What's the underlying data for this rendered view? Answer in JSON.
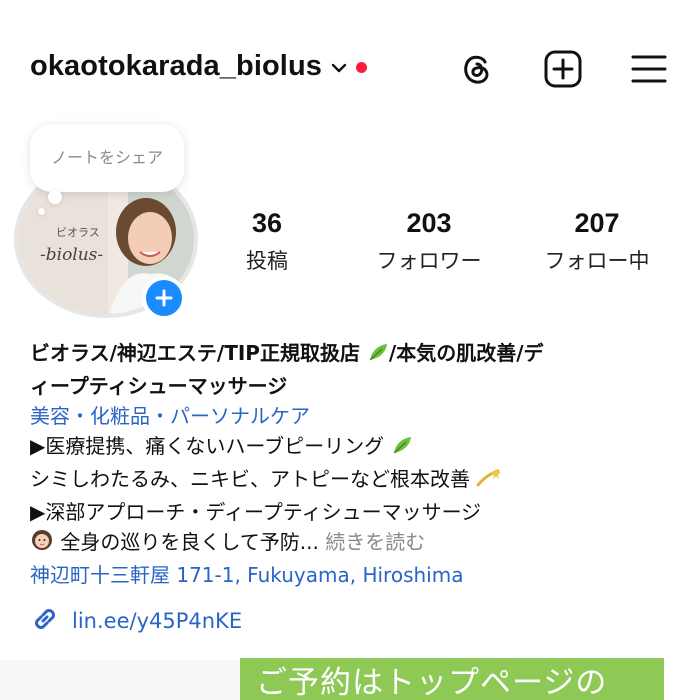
{
  "header": {
    "username": "okaotokarada_biolus",
    "notification_color": "#ff1a3c",
    "icons": [
      "chevron-down-icon",
      "threads-icon",
      "create-icon",
      "menu-icon"
    ]
  },
  "avatar": {
    "note_text": "ノートをシェア",
    "sign_line1": "ビオラス",
    "sign_line2": "-biolus-",
    "add_button_color": "#1a8cff"
  },
  "stats": {
    "posts": {
      "value": "36",
      "label": "投稿"
    },
    "followers": {
      "value": "203",
      "label": "フォロワー"
    },
    "following": {
      "value": "207",
      "label": "フォロー中"
    }
  },
  "bio": {
    "name_line1": "ビオラス/神辺エステ/TIP正規取扱店",
    "name_line1_tail": "/本気の肌改善/デ",
    "name_line2": "ィープティシューマッサージ",
    "category": "美容・化粧品・パーソナルケア",
    "line1": "▶医療提携、痛くないハーブピーリング",
    "line2": "シミしわたるみ、ニキビ、アトピーなど根本改善",
    "line3": "▶深部アプローチ・ディープティシューマッサージ",
    "line4": "全身の巡りを良くして予防...",
    "more": "続きを読む",
    "address": "神辺町十三軒屋 171-1, Fukuyama, Hiroshima",
    "link": "lin.ee/y45P4nKE",
    "link_color": "#2a64c8"
  },
  "banner": {
    "text": "ご予約はトップページの",
    "color": "#8ec956"
  }
}
